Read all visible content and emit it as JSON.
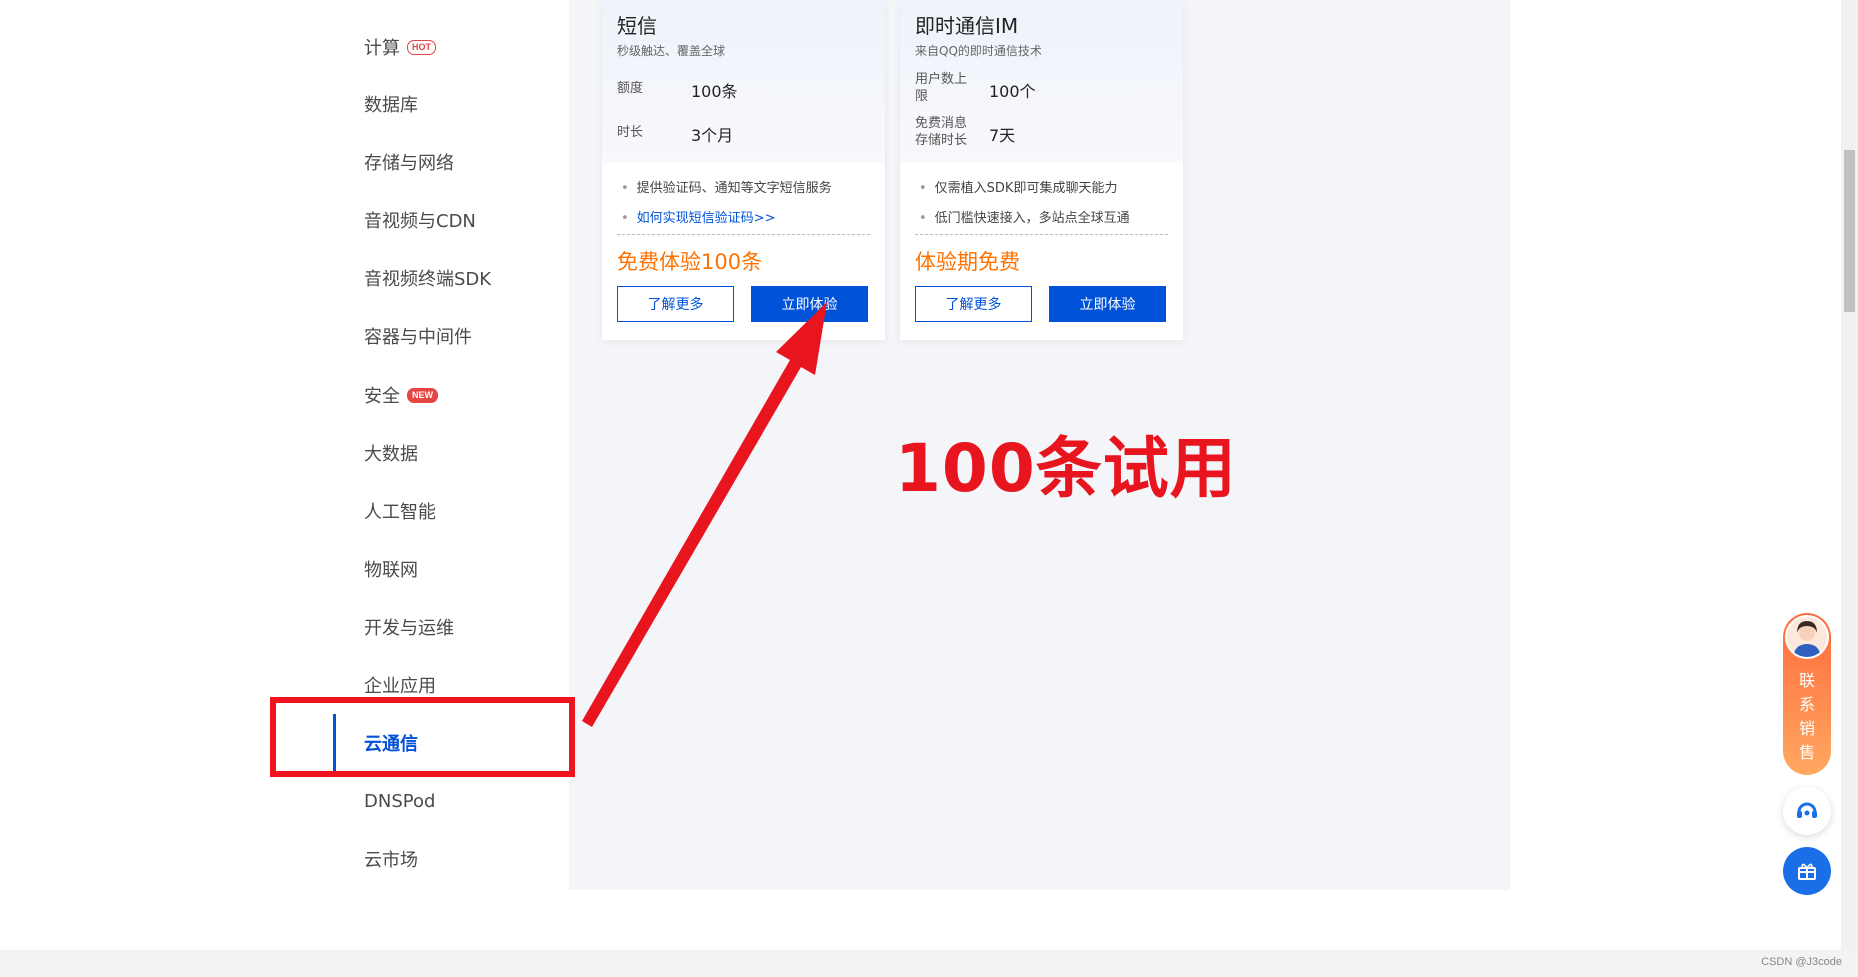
{
  "sidebar": {
    "items": [
      {
        "label": "计算",
        "badge": "HOT"
      },
      {
        "label": "数据库"
      },
      {
        "label": "存储与网络"
      },
      {
        "label": "音视频与CDN"
      },
      {
        "label": "音视频终端SDK"
      },
      {
        "label": "容器与中间件"
      },
      {
        "label": "安全",
        "badge": "NEW"
      },
      {
        "label": "大数据"
      },
      {
        "label": "人工智能"
      },
      {
        "label": "物联网"
      },
      {
        "label": "开发与运维"
      },
      {
        "label": "企业应用"
      },
      {
        "label": "云通信",
        "active": true
      },
      {
        "label": "DNSPod"
      },
      {
        "label": "云市场"
      }
    ]
  },
  "cards": [
    {
      "title": "短信",
      "subtitle": "秒级触达、覆盖全球",
      "spec1_label": "额度",
      "spec1_value": "100条",
      "spec2_label": "时长",
      "spec2_value": "3个月",
      "feature1": "提供验证码、通知等文字短信服务",
      "feature2": "如何实现短信验证码>>",
      "price": "免费体验100条",
      "learn_more": "了解更多",
      "try_now": "立即体验"
    },
    {
      "title": "即时通信IM",
      "subtitle": "来自QQ的即时通信技术",
      "spec1_label": "用户数上限",
      "spec1_value": "100个",
      "spec2_label": "免费消息存储时长",
      "spec2_value": "7天",
      "feature1": "仅需植入SDK即可集成聊天能力",
      "feature2": "低门槛快速接入，多站点全球互通",
      "price": "体验期免费",
      "learn_more": "了解更多",
      "try_now": "立即体验"
    }
  ],
  "annotation": {
    "text": "100条试用",
    "color": "#e8141e"
  },
  "float_panel": {
    "contact_label": "联\n系\n销\n售"
  },
  "watermark": "CSDN @J3code",
  "colors": {
    "brand": "#0052d9",
    "price": "#ff7200",
    "contact_gradient_top": "#ff6a3c",
    "contact_gradient_bottom": "#ffa860"
  }
}
